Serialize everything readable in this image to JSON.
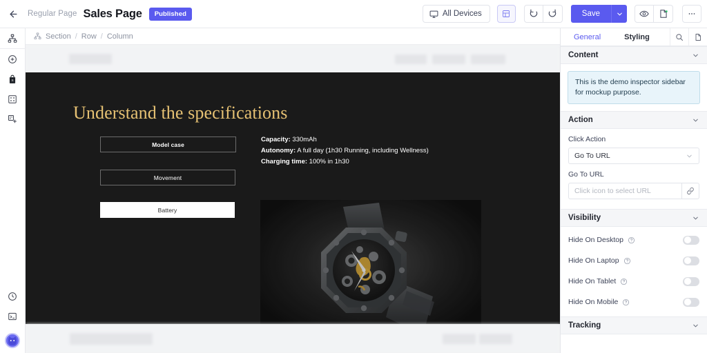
{
  "topbar": {
    "back_icon": "arrow-left-icon",
    "page_type": "Regular Page",
    "title": "Sales Page",
    "status_badge": "Published",
    "devices_label": "All Devices",
    "devices_icon": "monitor-icon",
    "grid_icon": "layout-grid-icon",
    "undo_icon": "undo-icon",
    "redo_icon": "redo-icon",
    "save_label": "Save",
    "save_caret_icon": "chevron-down-icon",
    "preview_icon": "eye-icon",
    "export_icon": "file-export-icon",
    "more_icon": "ellipsis-icon",
    "accent_color": "#5a5aef"
  },
  "rail": {
    "items": [
      {
        "name": "sitemap-icon",
        "label": "Structure"
      },
      {
        "name": "add-circle-icon",
        "label": "Add"
      },
      {
        "name": "shop-bag-icon",
        "label": "Shop"
      },
      {
        "name": "blocks-icon",
        "label": "Blocks"
      },
      {
        "name": "add-block-icon",
        "label": "Add Block"
      }
    ],
    "bottom_items": [
      {
        "name": "clock-icon",
        "label": "History"
      },
      {
        "name": "console-icon",
        "label": "Console"
      }
    ],
    "avatar_name": "user-avatar"
  },
  "breadcrumb": {
    "icon": "sitemap-icon",
    "items": [
      "Section",
      "Row",
      "Column"
    ],
    "separator": "/"
  },
  "canvas": {
    "hero": {
      "heading": "Understand the specifications",
      "heading_color": "#e6c173",
      "background": "#1a1a1a",
      "options": [
        {
          "label": "Model case",
          "style": "outline-bold"
        },
        {
          "label": "Movement",
          "style": "outline"
        },
        {
          "label": "Battery",
          "style": "filled"
        }
      ],
      "specs": [
        {
          "key": "Capacity:",
          "value": "330mAh"
        },
        {
          "key": "Autonomy:",
          "value": "A full day (1h30 Running, including Wellness)"
        },
        {
          "key": "Charging time:",
          "value": "100% in 1h30"
        }
      ],
      "image_name": "skeleton-watch-photo"
    }
  },
  "inspector": {
    "tabs": [
      {
        "label": "General",
        "active": true
      },
      {
        "label": "Styling",
        "active": false
      }
    ],
    "search_icon": "search-icon",
    "doc_icon": "document-icon",
    "sections": {
      "content": {
        "title": "Content",
        "chevron": "chevron-down-icon",
        "note": "This is the demo inspector sidebar for mockup purpose."
      },
      "action": {
        "title": "Action",
        "chevron": "chevron-down-icon",
        "click_action_label": "Click Action",
        "click_action_value": "Go To URL",
        "url_label": "Go To URL",
        "url_placeholder": "Click icon to select URL",
        "url_value": "",
        "link_icon": "link-icon"
      },
      "visibility": {
        "title": "Visibility",
        "chevron": "chevron-down-icon",
        "toggles": [
          {
            "label": "Hide On Desktop",
            "help_icon": "question-circle-icon",
            "on": false
          },
          {
            "label": "Hide On Laptop",
            "help_icon": "question-circle-icon",
            "on": false
          },
          {
            "label": "Hide On Tablet",
            "help_icon": "question-circle-icon",
            "on": false
          },
          {
            "label": "Hide On Mobile",
            "help_icon": "question-circle-icon",
            "on": false
          }
        ]
      },
      "tracking": {
        "title": "Tracking",
        "chevron": "chevron-down-icon"
      }
    }
  }
}
